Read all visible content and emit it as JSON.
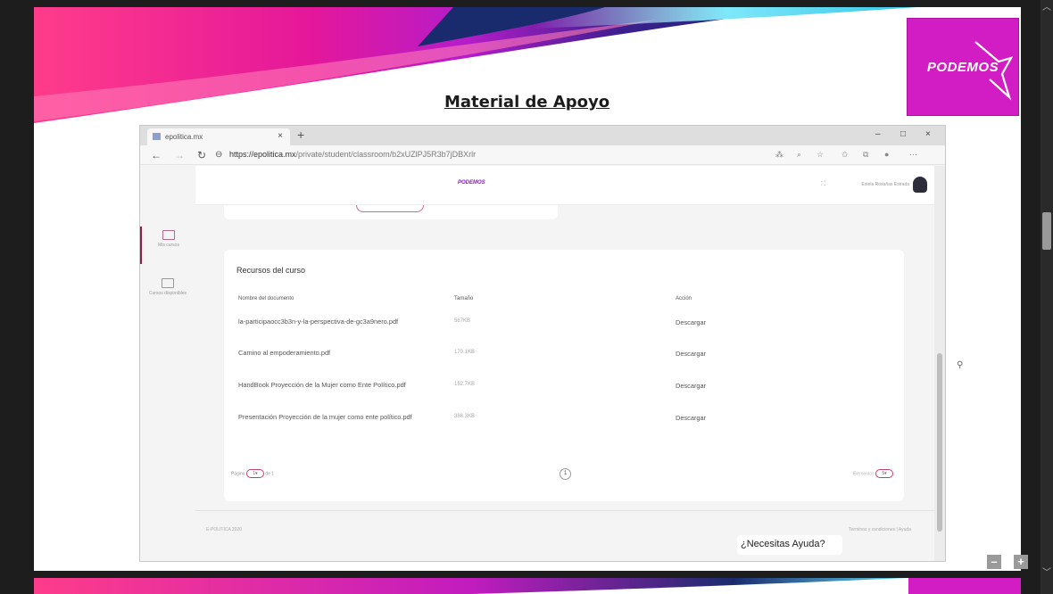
{
  "slide": {
    "title": "Material de Apoyo",
    "logo_text": "PODEMOS"
  },
  "browser": {
    "tab_title": "epolitica.mx",
    "tab_close": "×",
    "new_tab": "+",
    "url_domain": "https://epolitica.mx",
    "url_path": "/private/student/classroom/b2xUZlPJ5R3b7jDBXrlr",
    "window_controls": [
      "–",
      "□",
      "×"
    ],
    "nav": {
      "back": "←",
      "forward": "→",
      "reload": "↻"
    }
  },
  "site": {
    "logo": "PODEMOS",
    "user_name": "Estela Rosañas Estrada",
    "sidebar": [
      {
        "label": "Mis cursos"
      },
      {
        "label": "Cursos disponibles"
      }
    ],
    "resources": {
      "title": "Recursos del curso",
      "columns": [
        "Nombre del documento",
        "Tamaño",
        "Acción"
      ],
      "rows": [
        {
          "name": "la-participaocc3b3n-y-la-perspectiva-de-gc3a9nero.pdf",
          "size": "567KB",
          "action": "Descargar"
        },
        {
          "name": "Camino al empoderamiento.pdf",
          "size": "170.1KB",
          "action": "Descargar"
        },
        {
          "name": "HandBook Proyección de la Mujer como Ente Político.pdf",
          "size": "152.7KB",
          "action": "Descargar"
        },
        {
          "name": "Presentación Proyección de la mujer como ente político.pdf",
          "size": "388.3KB",
          "action": "Descargar"
        }
      ],
      "pager": {
        "page_label": "Página",
        "page_value": "1",
        "of_label": "de 1",
        "current": "1",
        "per_page_label": "Elementos",
        "per_page_value": "5"
      }
    },
    "footer": {
      "copyright": "E-POLITICA 2020",
      "links": "Terminos y condiciones  |  Ayuda"
    }
  },
  "help_button": "¿Necesitas Ayuda?",
  "viewer": {
    "zoom_out": "–",
    "zoom_in": "+"
  },
  "colors": {
    "brand_magenta": "#d31dc4",
    "accent_pink": "#c0406a",
    "swoosh_navy": "#1a2b6d",
    "swoosh_cyan": "#5fd6f0"
  }
}
